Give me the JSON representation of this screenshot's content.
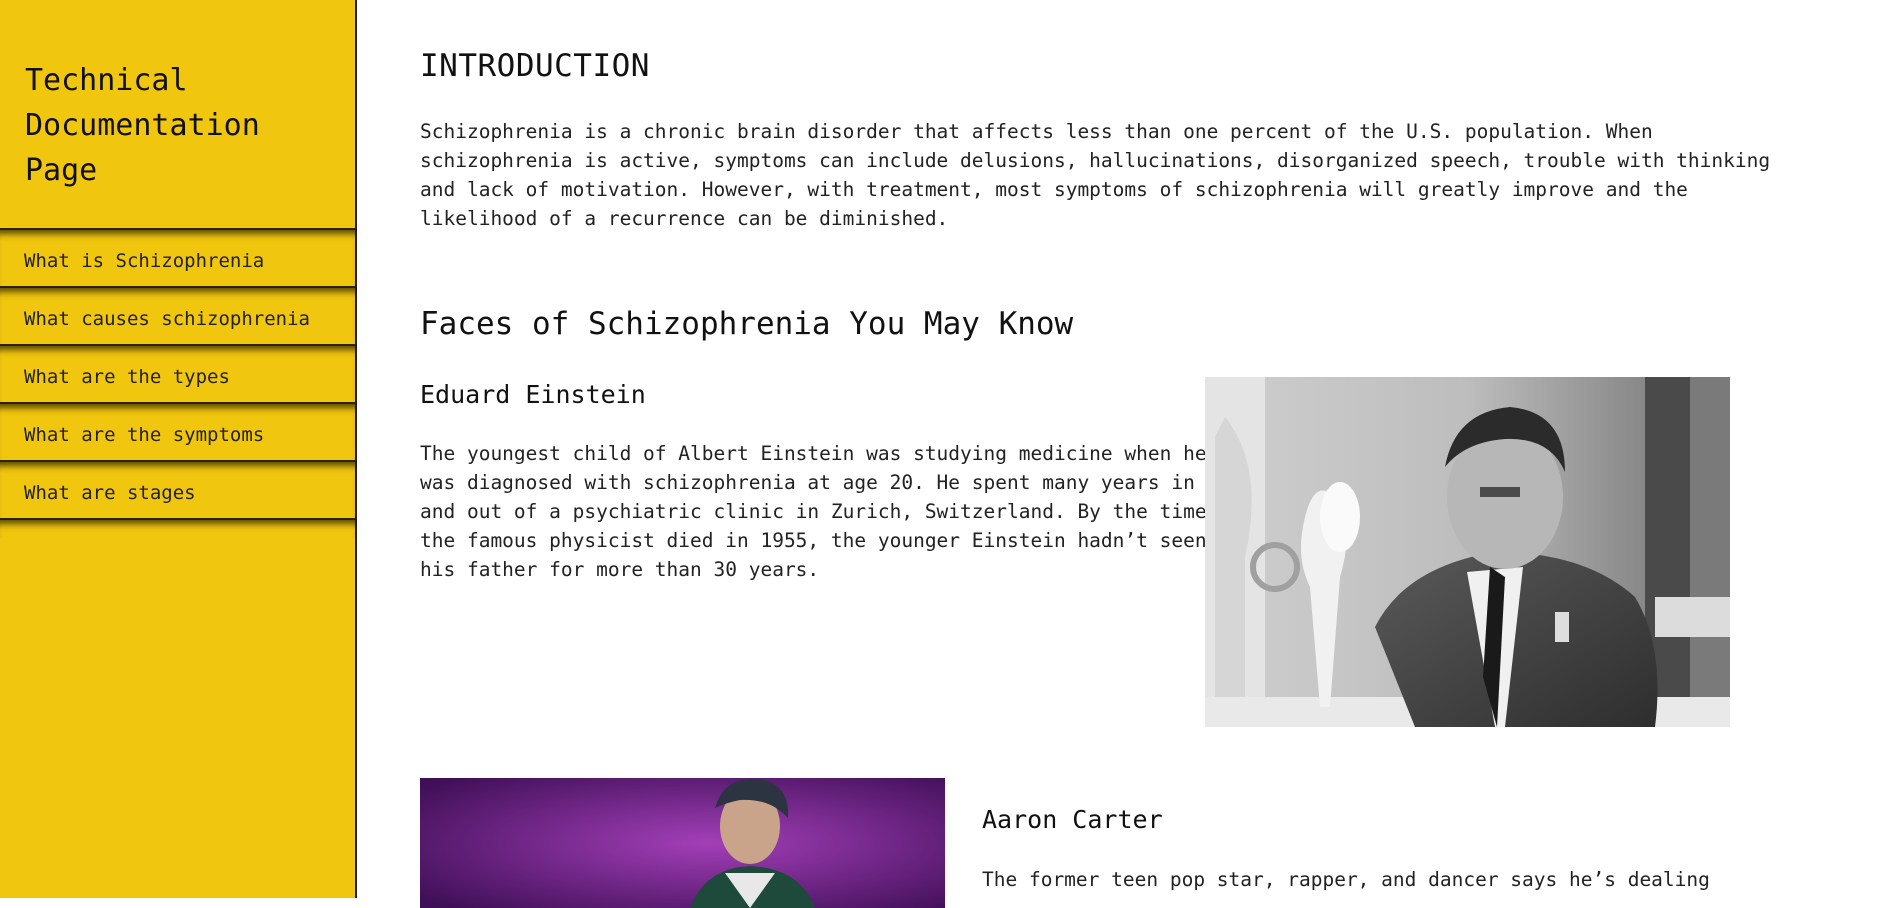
{
  "sidebar": {
    "title": "Technical Documentation Page",
    "nav_items": [
      {
        "label": "What is Schizophrenia"
      },
      {
        "label": "What causes schizophrenia"
      },
      {
        "label": "What are the types"
      },
      {
        "label": "What are the symptoms"
      },
      {
        "label": "What are stages"
      }
    ]
  },
  "main": {
    "intro_heading": "INTRODUCTION",
    "intro_text": "Schizophrenia is a chronic brain disorder that affects less than one percent of the U.S. population. When schizophrenia is active, symptoms can include delusions, hallucinations, disorganized speech, trouble with thinking and lack of motivation. However, with treatment, most symptoms of schizophrenia will greatly improve and the likelihood of a recurrence can be diminished.",
    "faces_heading": "Faces of Schizophrenia You May Know",
    "people": [
      {
        "name": "Eduard Einstein",
        "text": "The youngest child of Albert Einstein was studying medicine when he was diagnosed with schizophrenia at age 20. He spent many years in and out of a psychiatric clinic in Zurich, Switzerland. By the time the famous physicist died in 1955, the younger Einstein hadn’t seen his father for more than 30 years."
      },
      {
        "name": "Aaron Carter",
        "text": "The former teen pop star, rapper, and dancer says he’s dealing"
      }
    ]
  },
  "colors": {
    "sidebar_bg": "#f1c60e",
    "text": "#111111",
    "page_bg": "#ffffff"
  }
}
